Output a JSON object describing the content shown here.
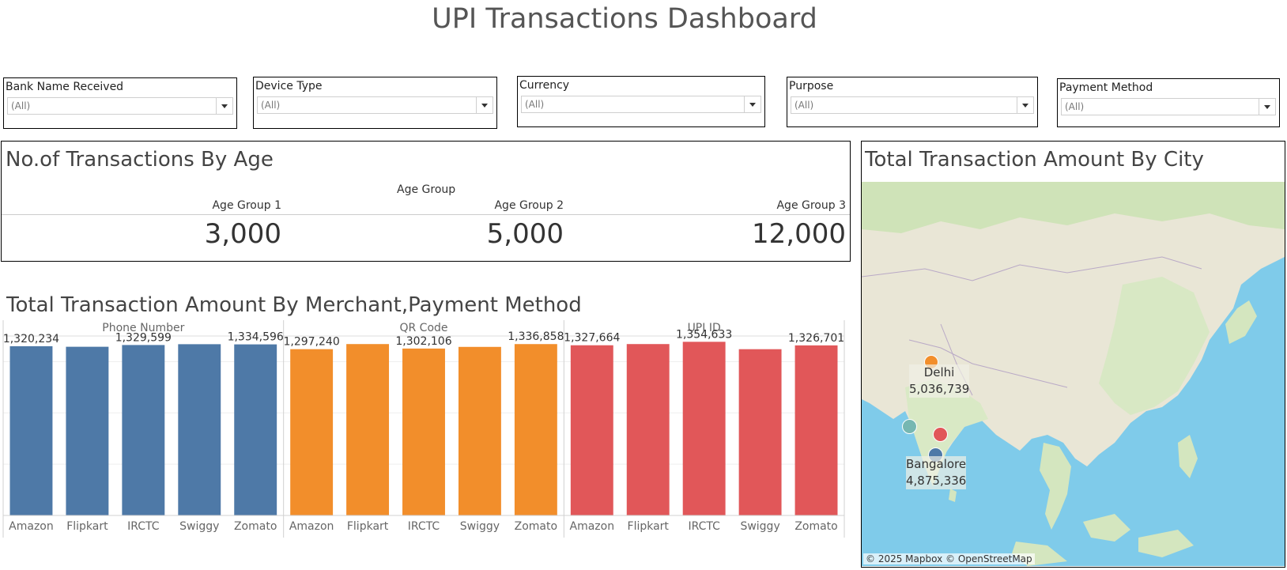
{
  "dashboard": {
    "title": "UPI Transactions Dashboard"
  },
  "filters": [
    {
      "label": "Bank Name Received",
      "value": "(All)"
    },
    {
      "label": "Device Type",
      "value": "(All)"
    },
    {
      "label": "Currency",
      "value": "(All)"
    },
    {
      "label": "Purpose",
      "value": "(All)"
    },
    {
      "label": "Payment Method",
      "value": "(All)"
    }
  ],
  "age_panel": {
    "title": "No.of Transactions By Age",
    "group_header": "Age Group",
    "groups": [
      {
        "label": "Age Group 1",
        "value": "3,000"
      },
      {
        "label": "Age Group 2",
        "value": "5,000"
      },
      {
        "label": "Age Group 3",
        "value": "12,000"
      }
    ]
  },
  "merchant_panel": {
    "title": "Total Transaction Amount By Merchant,Payment Method"
  },
  "chart_data": {
    "type": "bar",
    "title": "Total Transaction Amount By Merchant,Payment Method",
    "categories": [
      "Amazon",
      "Flipkart",
      "IRCTC",
      "Swiggy",
      "Zomato"
    ],
    "panes": [
      "Phone Number",
      "QR Code",
      "UPI ID"
    ],
    "ylim": [
      0,
      1400000
    ],
    "grid": true,
    "series": [
      {
        "name": "Phone Number",
        "color": "#4e79a7",
        "values": [
          1320234,
          1316000,
          1329599,
          1336000,
          1334596
        ],
        "labels": [
          "1,320,234",
          "",
          "1,329,599",
          "",
          "1,334,596"
        ]
      },
      {
        "name": "QR Code",
        "color": "#f28e2b",
        "values": [
          1297240,
          1337000,
          1302106,
          1315000,
          1336858
        ],
        "labels": [
          "1,297,240",
          "",
          "1,302,106",
          "",
          "1,336,858"
        ]
      },
      {
        "name": "UPI ID",
        "color": "#e15759",
        "values": [
          1327664,
          1337000,
          1354633,
          1297000,
          1326701
        ],
        "labels": [
          "1,327,664",
          "",
          "1,354,633",
          "",
          "1,326,701"
        ]
      }
    ]
  },
  "map_panel": {
    "title": "Total Transaction Amount By City",
    "attribution": "© 2025 Mapbox © OpenStreetMap",
    "cities": [
      {
        "name": "Delhi",
        "amount": "5,036,739",
        "color": "#f28e2b"
      },
      {
        "name": "Bangalore",
        "amount": "4,875,336",
        "color": "#4e79a7"
      },
      {
        "name": "",
        "amount": "",
        "color": "#76b7b2"
      },
      {
        "name": "",
        "amount": "",
        "color": "#e15759"
      }
    ]
  }
}
